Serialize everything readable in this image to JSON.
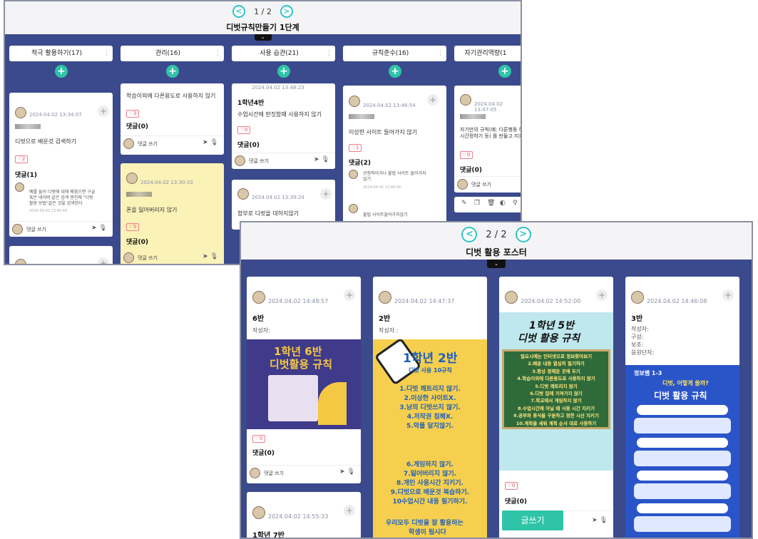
{
  "top": {
    "pager": {
      "prev": "<",
      "text": "1 / 2",
      "next": ">"
    },
    "title": "디벗규칙만들기 1단계",
    "toggle": "⌄",
    "columns": [
      {
        "label": "적극 활용하기(17)"
      },
      {
        "label": "관리(16)"
      },
      {
        "label": "사용 습관(21)"
      },
      {
        "label": "규칙준수(16)"
      },
      {
        "label": "자기관리역량(1"
      }
    ],
    "plus": "+",
    "cards": {
      "c1": {
        "date": "2024.04.02 13:34:07",
        "body": "디벗으로 배운것 검색하기",
        "likes": "♡2",
        "comments": "댓글(1)",
        "reply": "예를 들어 디벗에 대해 배웠으면 구글\n혹은 네이버 같은 검색 엔진에 \"디벗\n활용 방법\"같은 것을 검색한다",
        "reply_date": "2024-04-02 13:40:44"
      },
      "c2": {
        "body": "학습이외에 다른용도로 사용하지 않기",
        "likes": "♡3",
        "comments": "댓글(0)"
      },
      "c3": {
        "date": "2024.04.02 13:30:33",
        "body": "폰을 잃어버리지 않기",
        "likes": "♡5",
        "comments": "댓글(0)"
      },
      "c4": {
        "date": "2024.04.02 13:48:23",
        "heading": "1학년4반",
        "body": "수업시간에 딴짓함때 사용하지 않기",
        "likes": "♡0",
        "comments": "댓글(0)"
      },
      "c5": {
        "date": "2024.04.02 13:39:24",
        "body": "함부로 디벗을 대하지않기"
      },
      "c6": {
        "date": "2024.04.02 13:46:54",
        "body": "이상한 사이트 들어가지 않기",
        "likes": "♡1",
        "comments": "댓글(2)",
        "reply1": "선정적이거나 불법 사이트 들어가지\n않기",
        "reply1_date": "2024-04-02 13:48:24",
        "reply2": "불법 사이트들어가지않기"
      },
      "c7": {
        "date": "2024.04.02 13:47:05",
        "body": "자기만의 규칙(예: 다른행동 하\n시간정하기 등) 를 만들고 지키",
        "likes": "♡0",
        "comments": "댓글(0)"
      }
    },
    "write_label": "댓글 쓰기"
  },
  "bottom": {
    "pager": {
      "prev": "<",
      "text": "2 / 2",
      "next": ">"
    },
    "title": "디벗 활용 포스터",
    "toggle": "⌄",
    "cards": {
      "p1": {
        "date": "2024.04.02 14:48:57",
        "heading": "6반",
        "author": "작성자:",
        "likes": "♡0",
        "comments": "댓글(0)",
        "poster_title": "1학년 6반",
        "poster_sub": "디벗활용 규칙"
      },
      "p2": {
        "date": "2024.04.02 14:47:37",
        "heading": "2반",
        "author": "작성자 :",
        "poster_title": "1학년 2반",
        "poster_sub": "디벗 사용 10규칙",
        "rules_a": [
          "1.디벗 깨트리지 않기.",
          "2.이상한 사이트X.",
          "3.남의 디벗쓰지 않기.",
          "4.저작권 침해X.",
          "5.악플 달지않기."
        ],
        "rules_b": [
          "6.게임하지 않기.",
          "7.잃어버리지 않기.",
          "8.개인 사용시간 지키기.",
          "9.디벗으로 배운것 복습하기.",
          "10수업시간 내용 필기하기."
        ],
        "footer": "우리모두 디벗을 잘 활용하는",
        "footer2": "학생이 됩시다"
      },
      "p3": {
        "date": "2024.04.02 14:52:00",
        "poster_title": "1학년 5반",
        "poster_sub": "디벗 활용 규칙",
        "rules": [
          "필요시에는 인터넷으로 정보찾아보기",
          "2.배운 내용 열심히 필기하기",
          "3.항상 정해둔 곳에 두기",
          "4.학습이외에 다른용도로 사용하지 않기",
          "5.디벗 깨트리지 않기",
          "6.디벗 집에 가져가지 않기",
          "7.학교에서 게임하지 않기",
          "8.수업시간에 아닐 때 사용 시간 지키기",
          "9.공부와 휴식을 구분하고 정한 시산 지키기",
          "10.계획을 세워 계획 순서 대로 사용하기"
        ],
        "likes": "♡0",
        "comments": "댓글(0)",
        "write_btn": "글쓰기"
      },
      "p4": {
        "date": "2024.04.02 14:46:08",
        "heading": "3반",
        "lines": [
          "작성자:",
          "구성:",
          "보조:",
          "응원단자:"
        ],
        "poster_badge": "정보쌤 1-3",
        "poster_tag": "디벗, 어떻게 쓸까?",
        "poster_sub": "디벗 활용 규칙"
      },
      "p5": {
        "date": "2024.04.02 14:55:33",
        "heading": "1학년 7반"
      }
    },
    "write_label": "댓글 쓰기"
  }
}
